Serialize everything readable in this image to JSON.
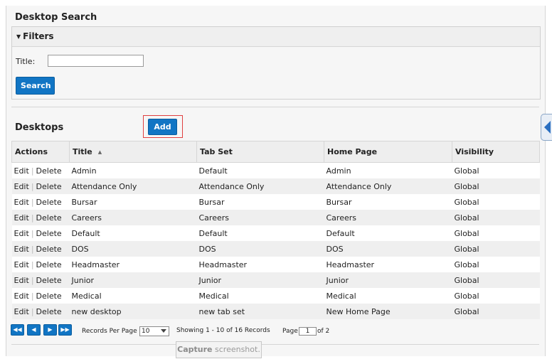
{
  "desktop_search": {
    "title": "Desktop Search",
    "filters": {
      "header": "Filters",
      "title_label": "Title:",
      "title_value": "",
      "search_label": "Search"
    }
  },
  "desktops": {
    "title": "Desktops",
    "add_label": "Add",
    "columns": [
      "Actions",
      "Title",
      "Tab Set",
      "Home Page",
      "Visibility"
    ],
    "edit_label": "Edit",
    "delete_label": "Delete",
    "rows": [
      {
        "title": "Admin",
        "tab_set": "Default",
        "home_page": "Admin",
        "visibility": "Global"
      },
      {
        "title": "Attendance Only",
        "tab_set": "Attendance Only",
        "home_page": "Attendance Only",
        "visibility": "Global"
      },
      {
        "title": "Bursar",
        "tab_set": "Bursar",
        "home_page": "Bursar",
        "visibility": "Global"
      },
      {
        "title": "Careers",
        "tab_set": "Careers",
        "home_page": "Careers",
        "visibility": "Global"
      },
      {
        "title": "Default",
        "tab_set": "Default",
        "home_page": "Default",
        "visibility": "Global"
      },
      {
        "title": "DOS",
        "tab_set": "DOS",
        "home_page": "DOS",
        "visibility": "Global"
      },
      {
        "title": "Headmaster",
        "tab_set": "Headmaster",
        "home_page": "Headmaster",
        "visibility": "Global"
      },
      {
        "title": "Junior",
        "tab_set": "Junior",
        "home_page": "Junior",
        "visibility": "Global"
      },
      {
        "title": "Medical",
        "tab_set": "Medical",
        "home_page": "Medical",
        "visibility": "Global"
      },
      {
        "title": "new desktop",
        "tab_set": "new tab set",
        "home_page": "New Home Page",
        "visibility": "Global"
      }
    ]
  },
  "pager": {
    "records_per_page_label": "Records Per Page",
    "records_per_page_value": "10",
    "showing_text": "Showing 1 - 10 of 16 Records",
    "page_label": "Page",
    "page_value": "1",
    "of_text": "of 2",
    "icons": [
      "first-page-icon",
      "prev-page-icon",
      "next-page-icon",
      "last-page-icon"
    ]
  },
  "capture_tooltip": {
    "bold": "Capture",
    "rest": " screenshot."
  },
  "colors": {
    "button_blue": "#1175c4",
    "highlight_red": "#e04040",
    "panel_bg": "#f6f6f6",
    "row_alt": "#efefef"
  }
}
